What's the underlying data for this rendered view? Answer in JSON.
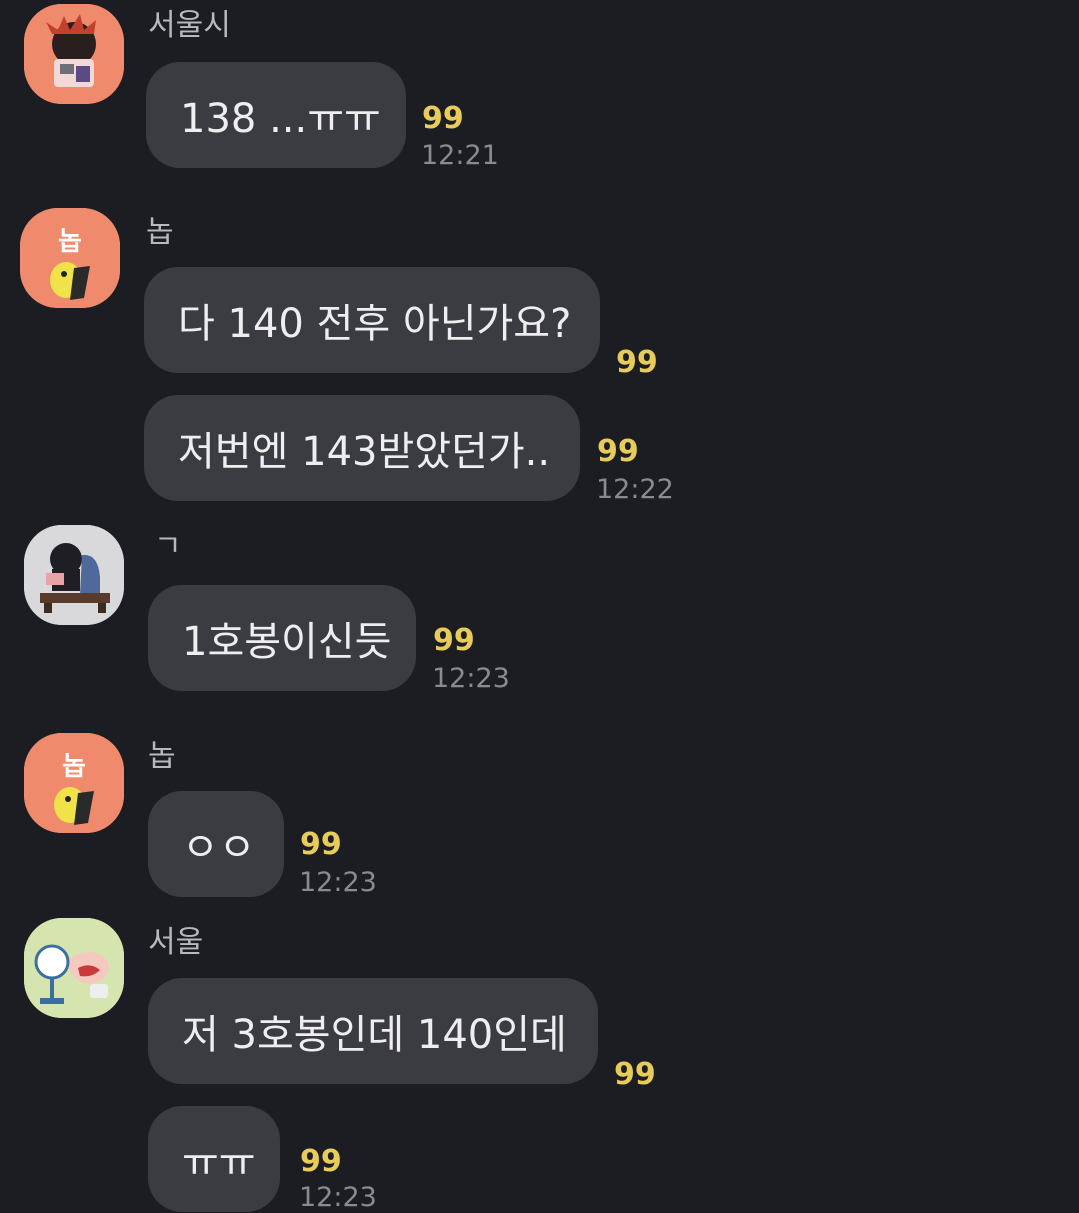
{
  "chat": {
    "messages": [
      {
        "sender": "서울시",
        "text": "138 ...ㅠㅠ",
        "unread": "99",
        "time": "12:21"
      },
      {
        "sender": "놉",
        "text": "다 140 전후 아닌가요?",
        "unread": "99",
        "time": ""
      },
      {
        "sender": "",
        "text": "저번엔 143받았던가..",
        "unread": "99",
        "time": "12:22"
      },
      {
        "sender": "ㄱ",
        "text": "1호봉이신듯",
        "unread": "99",
        "time": "12:23"
      },
      {
        "sender": "놉",
        "text": "ㅇㅇ",
        "unread": "99",
        "time": "12:23"
      },
      {
        "sender": "서울",
        "text": "저 3호봉인데 140인데",
        "unread": "99",
        "time": ""
      },
      {
        "sender": "",
        "text": "ㅠㅠ",
        "unread": "99",
        "time": "12:23"
      }
    ],
    "avatars": [
      {
        "name": "avatar-seoulsi",
        "bg": "#f08a6c"
      },
      {
        "name": "avatar-nop",
        "bg": "#f08a6c",
        "text": "놉"
      },
      {
        "name": "avatar-giyeok",
        "bg": "#d9d9dc"
      },
      {
        "name": "avatar-nop",
        "bg": "#f08a6c",
        "text": "놉"
      },
      {
        "name": "avatar-seoul",
        "bg": "#d6e4b0"
      }
    ]
  },
  "colors": {
    "background": "#1c1d22",
    "bubble": "#3b3c42",
    "unread": "#e8cc5a",
    "time": "#8a8b91"
  }
}
